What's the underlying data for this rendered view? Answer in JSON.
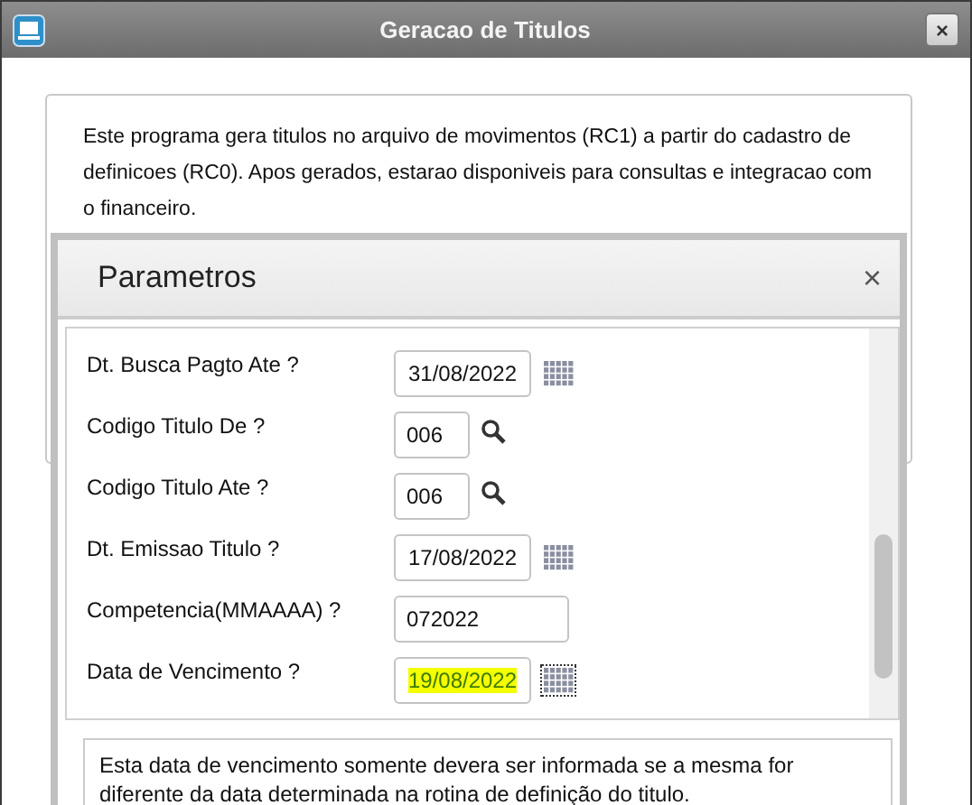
{
  "window": {
    "title": "Geracao de Titulos",
    "close": "×"
  },
  "description": "Este programa gera titulos no  arquivo  de  movimentos (RC1) a partir do cadastro de definicoes (RC0). Apos gerados, estarao disponiveis para consultas e integracao com o financeiro.",
  "dialog": {
    "title": "Parametros",
    "close": "×",
    "fields": [
      {
        "label": "Dt. Busca Pagto Ate ?",
        "value": "31/08/2022",
        "kind": "date",
        "selected": false
      },
      {
        "label": "Codigo Titulo De ?",
        "value": "006",
        "kind": "lookup",
        "selected": false
      },
      {
        "label": "Codigo Titulo Ate ?",
        "value": "006",
        "kind": "lookup",
        "selected": false
      },
      {
        "label": "Dt. Emissao Titulo ?",
        "value": "17/08/2022",
        "kind": "date",
        "selected": false
      },
      {
        "label": "Competencia(MMAAAA) ?",
        "value": "072022",
        "kind": "text",
        "selected": false
      },
      {
        "label": "Data de Vencimento ?",
        "value": "19/08/2022",
        "kind": "date",
        "selected": true
      }
    ],
    "help": "Esta data de vencimento somente devera ser informada se a mesma for diferente da data determinada na rotina de definição do titulo."
  }
}
